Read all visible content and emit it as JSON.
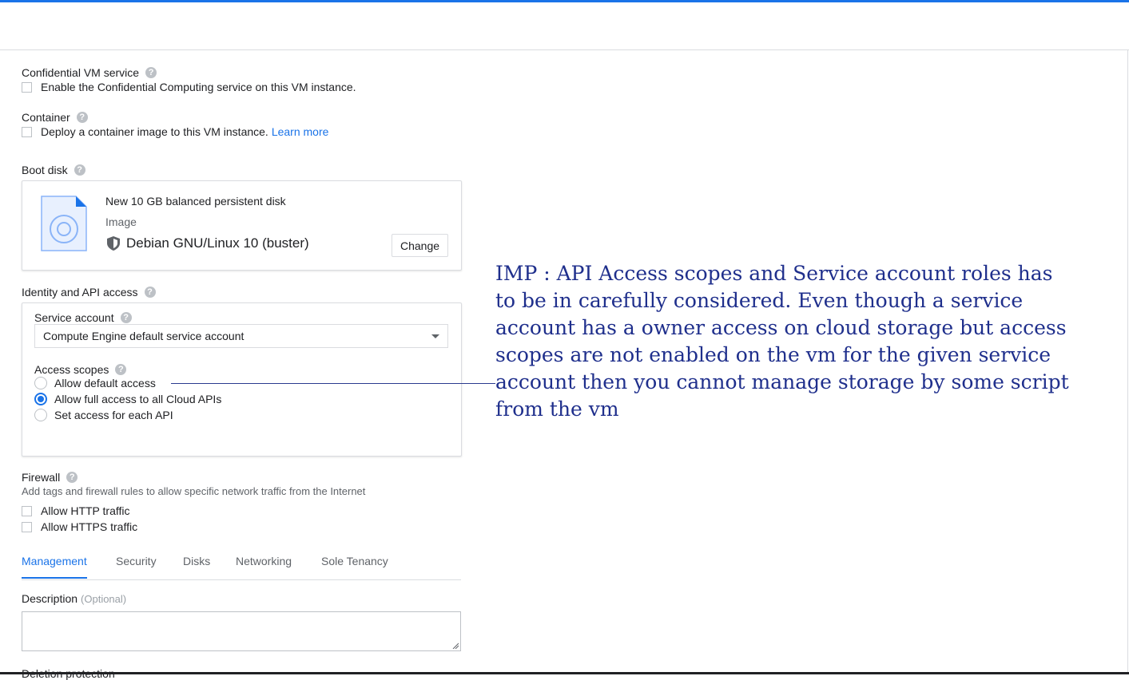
{
  "confidential": {
    "title": "Confidential VM service",
    "checkbox_label": "Enable the Confidential Computing service on this VM instance."
  },
  "container": {
    "title": "Container",
    "checkbox_label": "Deploy a container image to this VM instance.",
    "link": "Learn more"
  },
  "boot_disk": {
    "title": "Boot disk",
    "disk_title": "New 10 GB balanced persistent disk",
    "image_label": "Image",
    "image_name": "Debian GNU/Linux 10 (buster)",
    "change_label": "Change"
  },
  "identity": {
    "title": "Identity and API access",
    "service_account_label": "Service account",
    "service_account_value": "Compute Engine default service account",
    "access_scopes_label": "Access scopes",
    "scopes": [
      {
        "label": "Allow default access",
        "selected": false
      },
      {
        "label": "Allow full access to all Cloud APIs",
        "selected": true
      },
      {
        "label": "Set access for each API",
        "selected": false
      }
    ]
  },
  "firewall": {
    "title": "Firewall",
    "description": "Add tags and firewall rules to allow specific network traffic from the Internet",
    "options": [
      "Allow HTTP traffic",
      "Allow HTTPS traffic"
    ]
  },
  "tabs": [
    "Management",
    "Security",
    "Disks",
    "Networking",
    "Sole Tenancy"
  ],
  "description": {
    "label": "Description",
    "optional": "(Optional)"
  },
  "cut_off_label": "Deletion protection",
  "annotation": {
    "lines": [
      "IMP : API Access scopes and Service account roles has",
      "to be in carefully considered. Even though a service",
      "account has a owner access on cloud storage but access",
      "scopes are not enabled on the vm for the given service",
      "account then you cannot manage storage by  some script",
      "from the vm"
    ]
  },
  "colors": {
    "accent": "#1a73e8",
    "annotation": "#1f2f8c"
  }
}
